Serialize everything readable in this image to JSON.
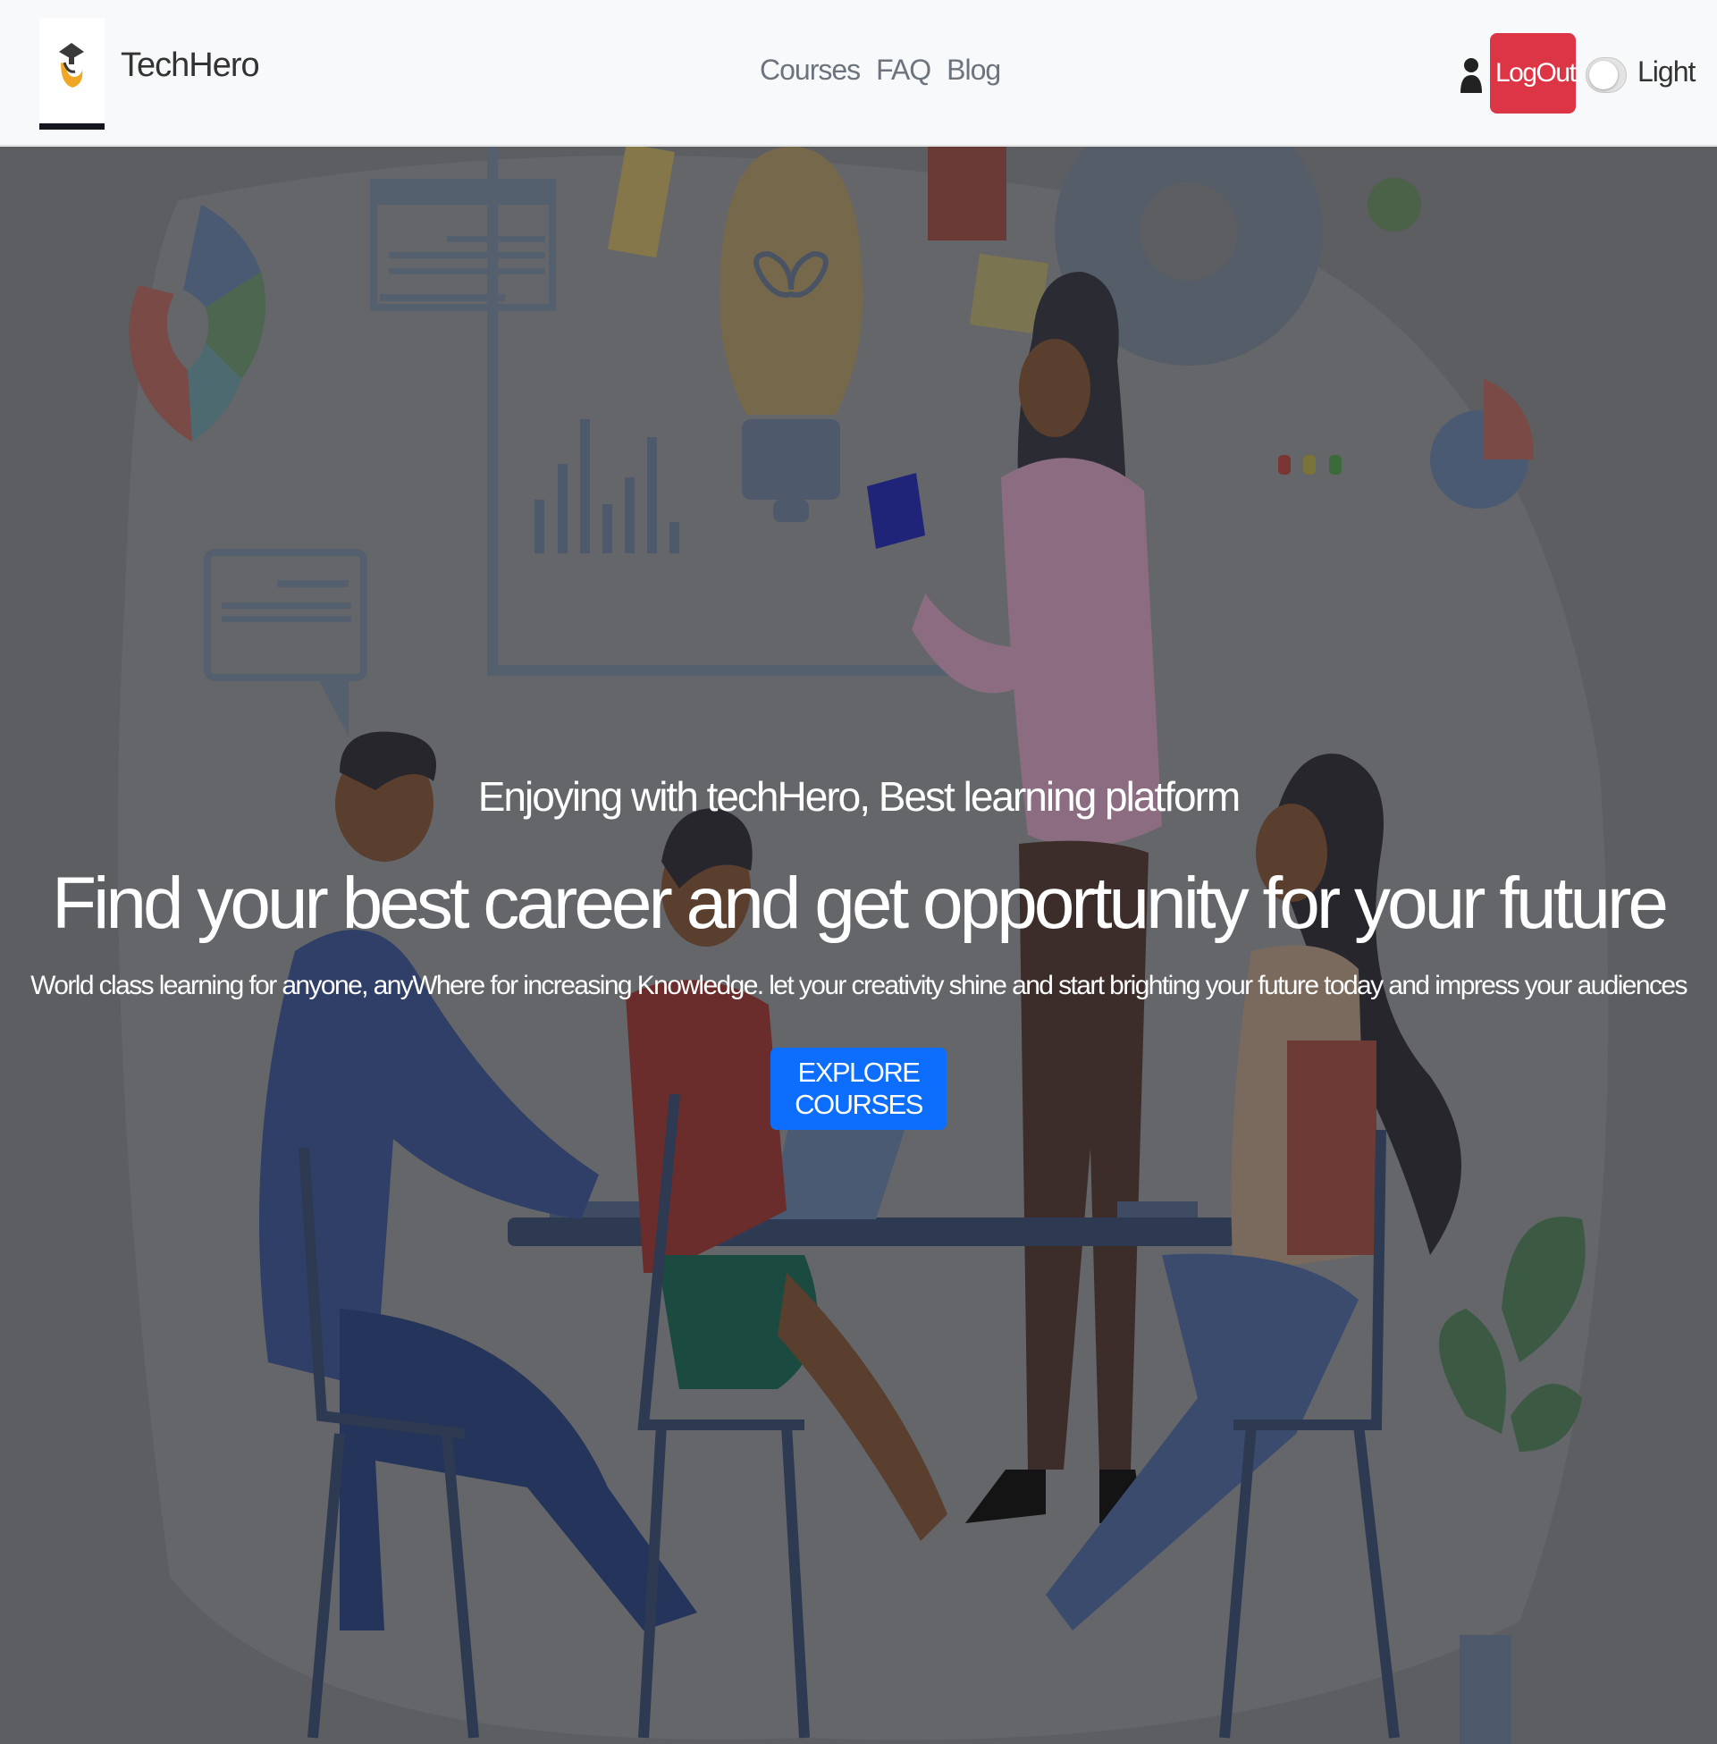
{
  "navbar": {
    "brand_name": "TechHero",
    "links": [
      "Courses",
      "FAQ",
      "Blog"
    ],
    "logout_label": "LogOut",
    "theme_label": "Light"
  },
  "hero": {
    "subtitle": "Enjoying with techHero, Best learning platform",
    "title": "Find your best career and get opportunity for your future",
    "description": "World class learning for anyone, anyWhere for increasing Knowledge. let your creativity shine and start brighting your future today and impress your audiences",
    "cta_label": "EXPLORE COURSES"
  },
  "colors": {
    "navbar_bg": "#f8f9fa",
    "logout": "#dc3545",
    "primary": "#0d6efd",
    "hero_overlay": "#5c5e61"
  },
  "icons": {
    "brand": "graduation-cap-logo",
    "user": "user-icon"
  }
}
